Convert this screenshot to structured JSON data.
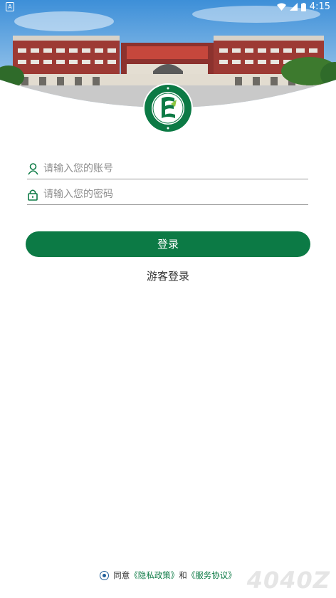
{
  "status_bar": {
    "indicator": "A",
    "time": "4:15"
  },
  "login": {
    "account_placeholder": "请输入您的账号",
    "password_placeholder": "请输入您的密码",
    "login_label": "登录",
    "guest_label": "游客登录"
  },
  "agreement": {
    "prefix": "同意",
    "privacy_link": "《隐私政策》",
    "and": "和",
    "service_link": "《服务协议》"
  },
  "watermark": "4040Z",
  "colors": {
    "primary": "#0c7a45",
    "link": "#0c7a45",
    "radio": "#1f5f9a"
  }
}
